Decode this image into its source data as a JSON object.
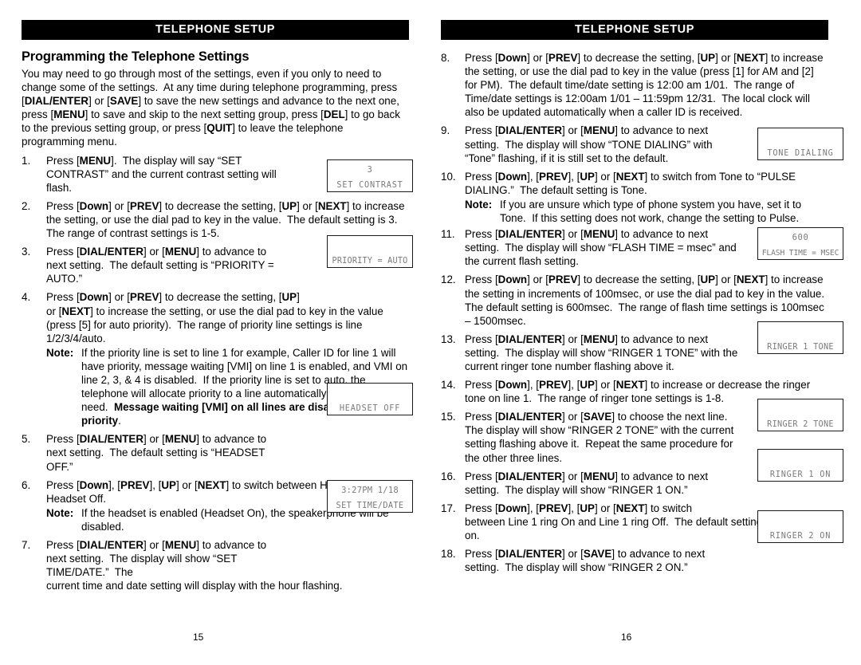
{
  "document": {
    "title": "TELEPHONE SETUP",
    "left_page": {
      "banner": "TELEPHONE SETUP",
      "folio": "15",
      "section_title": "Programming the Telephone Settings",
      "intro": "You may need to go through most of the settings, even if you only to need to change some of the settings.  At any time during telephone programming, press [DIAL/ENTER] or [SAVE] to save the new settings and advance to the next one, press [MENU] to save and skip to the next setting group, press [DEL] to go back to the previous setting group, or press [QUIT] to leave the telephone programming menu.",
      "steps": [
        {
          "num": "1.",
          "text": "Press [MENU].  The display will say “SET CONTRAST” and the current contrast setting will flash."
        },
        {
          "num": "2.",
          "text": "Press [Down] or [PREV] to decrease the setting, [UP] or [NEXT] to increase the setting, or use the dial pad to key in the value.  The default setting is 3.  The range of contrast settings is 1-5."
        },
        {
          "num": "3.",
          "text": "Press [DIAL/ENTER] or [MENU] to advance to next setting.  The default setting is “PRIORITY = AUTO.”"
        },
        {
          "num": "4.",
          "text": "Press [Down] or [PREV] to decrease the setting, [UP] or [NEXT] to increase the setting, or use the dial pad to key in the value (press [5] for auto priority).  The range of priority line settings is line 1/2/3/4/auto."
        },
        {
          "num": "5.",
          "text": "Press [DIAL/ENTER] or [MENU] to advance to next setting.  The default setting is “HEADSET OFF.”"
        },
        {
          "num": "6.",
          "text": "Press [Down], [PREV], [UP] or [NEXT] to switch between Headset On and Headset Off."
        },
        {
          "num": "7.",
          "text": "Press [DIAL/ENTER] or [MENU] to advance to next setting.  The display will show “SET TIME/DATE.”  The current time and date setting will display with the hour flashing."
        }
      ],
      "note_4": {
        "label": "Note:",
        "text": "If the priority line is set to line 1 for example, Caller ID for line 1 will have priority, message waiting [VMI] on line 1 is enabled, and VMI on line 2, 3, & 4 is disabled.  If the priority line is set to auto, the telephone will allocate priority to a line automatically depending on need.  Message waiting [VMI] on all lines are disabled on auto priority."
      },
      "note_6": {
        "label": "Note:",
        "text": "If the headset is enabled (Headset On), the speakerphone will be disabled."
      },
      "lcds": [
        {
          "name": "lcd-set-contrast",
          "top": "3",
          "bottom": "SET CONTRAST"
        },
        {
          "name": "lcd-priority-auto",
          "top": "",
          "bottom": "PRIORITY = AUTO"
        },
        {
          "name": "lcd-headset-off",
          "top": "",
          "bottom": "HEADSET OFF"
        },
        {
          "name": "lcd-set-time-date",
          "top": "3:27PM 1/18",
          "bottom": "SET TIME/DATE"
        }
      ]
    },
    "right_page": {
      "banner": "TELEPHONE SETUP",
      "folio": "16",
      "steps": [
        {
          "num": "8.",
          "text": "Press [Down] or [PREV] to decrease the setting, [UP] or [NEXT] to increase the setting, or use the dial pad to key in the value (press [1] for AM and [2] for PM).  The default time/date setting is 12:00 am 1/01.  The range of Time/date settings is 12:00am 1/01 – 11:59pm 12/31.  The local clock will also be updated automatically when a caller ID is received."
        },
        {
          "num": "9.",
          "text": "Press [DIAL/ENTER] or [MENU] to advance to next setting.  The display will show “TONE DIALING” with “Tone” flashing, if it is still set to the default."
        },
        {
          "num": "10.",
          "text": "Press [Down], [PREV], [UP] or [NEXT] to switch from Tone to “PULSE DIALING.”  The default setting is Tone."
        },
        {
          "num": "11.",
          "text": "Press [DIAL/ENTER] or [MENU] to advance to next setting.  The display will show “FLASH TIME = msec” and the current flash setting."
        },
        {
          "num": "12.",
          "text": "Press [Down] or [PREV] to decrease the setting, [UP] or [NEXT] to increase the setting in increments of 100msec, or use the dial pad to key in the value.  The default setting is 600msec.  The range of flash time settings is 100msec – 1500msec."
        },
        {
          "num": "13.",
          "text": "Press [DIAL/ENTER] or [MENU] to advance to next setting.  The display will show “RINGER 1 TONE” with the current ringer tone number flashing above it."
        },
        {
          "num": "14.",
          "text": "Press [Down], [PREV], [UP] or [NEXT] to increase or decrease the ringer tone on line 1.  The range of ringer tone settings is 1-8."
        },
        {
          "num": "15.",
          "text": "Press [DIAL/ENTER] or [SAVE] to choose the next line.  The display will show “RINGER 2 TONE” with the current setting flashing above it.  Repeat the same procedure for the other three lines."
        },
        {
          "num": "16.",
          "text": "Press [DIAL/ENTER] or [MENU] to advance to next setting.  The display will show “RINGER 1 ON.”"
        },
        {
          "num": "17.",
          "text": "Press [Down], [PREV], [UP] or [NEXT] to switch between Line 1 ring On and Line 1 ring Off.  The default setting is all lines on."
        },
        {
          "num": "18.",
          "text": "Press [DIAL/ENTER] or [SAVE] to advance to next setting.  The display will show “RINGER 2 ON.”"
        }
      ],
      "note_10": {
        "label": "Note:",
        "text": "If you are unsure which type of phone system you have, set it to Tone.  If this setting does not work, change the setting to Pulse."
      },
      "lcds": [
        {
          "name": "lcd-tone-dialing",
          "top": "",
          "bottom": "TONE DIALING"
        },
        {
          "name": "lcd-flash-time",
          "top": "600",
          "bottom": "FLASH TIME = MSEC"
        },
        {
          "name": "lcd-ringer-1-tone",
          "top": "",
          "bottom": "RINGER 1 TONE"
        },
        {
          "name": "lcd-ringer-2-tone",
          "top": "",
          "bottom": "RINGER 2 TONE"
        },
        {
          "name": "lcd-ringer-1-on",
          "top": "",
          "bottom": "RINGER 1 ON"
        },
        {
          "name": "lcd-ringer-2-on",
          "top": "",
          "bottom": "RINGER 2 ON"
        }
      ]
    },
    "colors": {
      "banner_bg": "#000000",
      "banner_text": "#ffffff",
      "body_text": "#000000",
      "lcd_text": "#7a7a7a",
      "lcd_border": "#1a1a1a"
    }
  }
}
